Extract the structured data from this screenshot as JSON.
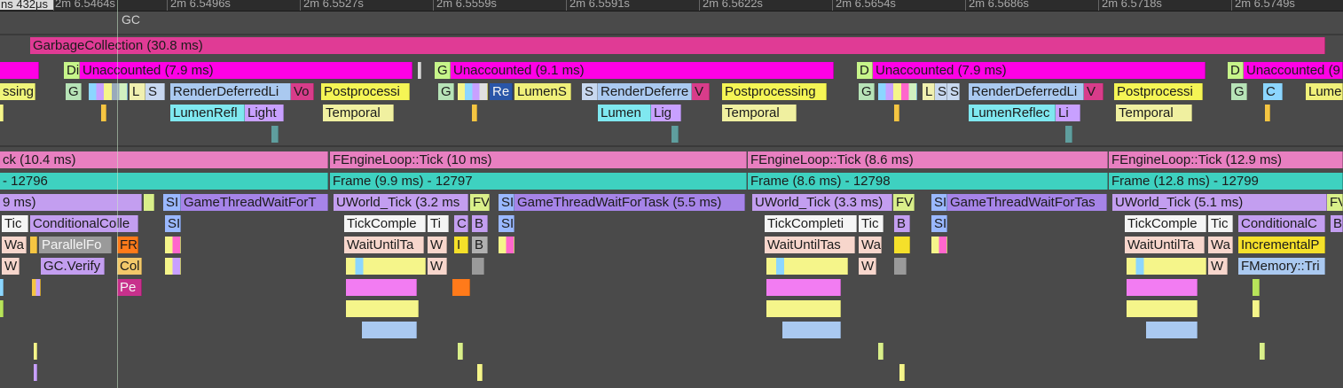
{
  "ruler": {
    "cursor_time": "ns 432μs",
    "ticks": [
      "2m 6.5464s",
      "2m 6.5496s",
      "2m 6.5527s",
      "2m 6.5559s",
      "2m 6.5591s",
      "2m 6.5622s",
      "2m 6.5654s",
      "2m 6.5686s",
      "2m 6.5718s",
      "2m 6.5749s"
    ]
  },
  "gpu_track": {
    "header": "GC",
    "gc": "GarbageCollection (30.8 ms)",
    "row1": [
      "Unaccounted (7.9 ms)",
      "Unaccounted (9.1 ms)",
      "Unaccounted (7.9 ms)",
      "Unaccounted (9",
      "Di",
      "G",
      "D",
      "D"
    ],
    "row2": [
      "ssing",
      "G",
      "L",
      "S",
      "RenderDeferredLi",
      "Vo",
      "Postprocessi",
      "G",
      "Re",
      "LumenS",
      "S",
      "RenderDeferre",
      "V",
      "Postprocessing",
      "G",
      "L",
      "S",
      "S",
      "RenderDeferredLi",
      "V",
      "Postprocessi",
      "G",
      "C",
      "Lume"
    ],
    "row3": [
      "LumenRefl",
      "Light",
      "Temporal",
      "Lumen",
      "Lig",
      "Temporal",
      "LumenReflec",
      "Li",
      "Temporal"
    ]
  },
  "game_track": {
    "tick": [
      "ck (10.4 ms)",
      "FEngineLoop::Tick (10 ms)",
      "FEngineLoop::Tick (8.6 ms)",
      "FEngineLoop::Tick (12.9 ms)"
    ],
    "frame": [
      "- 12796",
      "Frame (9.9 ms) -  12797",
      "Frame (8.6 ms) -  12798",
      "Frame (12.8 ms) -  12799"
    ],
    "row3": [
      "9 ms)",
      "SI",
      "GameThreadWaitForT",
      "UWorld_Tick (3.2 ms",
      "FV",
      "SI",
      "GameThreadWaitForTask (5.5 ms)",
      "UWorld_Tick (3.3 ms)",
      "FV",
      "SI",
      "GameThreadWaitForTas",
      "UWorld_Tick (5.1 ms)",
      "FV"
    ],
    "row4": [
      "Tic",
      "ConditionalColle",
      "SI",
      "TickComple",
      "Ti",
      "C",
      "B",
      "SI",
      "TickCompleti",
      "Tic",
      "B",
      "SI",
      "TickComple",
      "Tic",
      "ConditionalC",
      "B"
    ],
    "row5": [
      "Wa",
      "ParallelFo",
      "FR",
      "WaitUntilTa",
      "W",
      "I",
      "B",
      "WaitUntilTas",
      "Wa",
      "WaitUntilTa",
      "Wa",
      "IncrementalP"
    ],
    "row6": [
      "W",
      "GC.Verify",
      "Col",
      "W",
      "W",
      "W",
      "FMemory::Tri"
    ],
    "row7": [
      "Pe"
    ]
  }
}
